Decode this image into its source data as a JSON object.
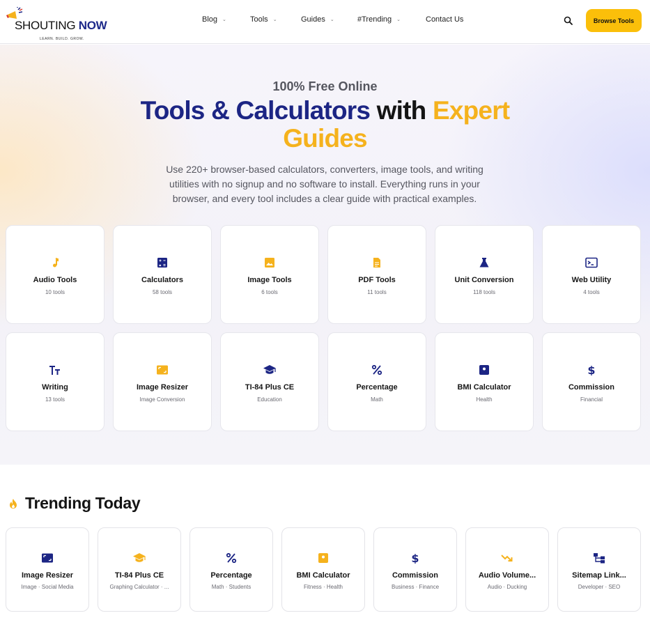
{
  "header": {
    "logo_main": "SHOUTING",
    "logo_accent": "NOW",
    "logo_tagline": "LEARN. BUILD. GROW.",
    "nav": [
      {
        "label": "Blog",
        "has_dropdown": true
      },
      {
        "label": "Tools",
        "has_dropdown": true
      },
      {
        "label": "Guides",
        "has_dropdown": true
      },
      {
        "label": "#Trending",
        "has_dropdown": true
      },
      {
        "label": "Contact Us",
        "has_dropdown": false
      }
    ],
    "search_icon": "search-icon",
    "cta_label": "Browse Tools"
  },
  "hero": {
    "eyebrow": "100% Free Online",
    "title_part1": "Tools & Calculators",
    "title_part2": "with",
    "title_part3": "Expert",
    "title_part4": "Guides",
    "description": "Use 220+ browser-based calculators, converters, image tools, and writing utilities with no signup and no software to install. Everything runs in your browser, and every tool includes a clear guide with practical examples."
  },
  "categories": [
    {
      "title": "Audio Tools",
      "subtitle": "10 tools",
      "icon": "music-note-icon",
      "color": "#f5b21d"
    },
    {
      "title": "Calculators",
      "subtitle": "58 tools",
      "icon": "calculator-icon",
      "color": "#1c2584"
    },
    {
      "title": "Image Tools",
      "subtitle": "6 tools",
      "icon": "image-icon",
      "color": "#f5b21d"
    },
    {
      "title": "PDF Tools",
      "subtitle": "11 tools",
      "icon": "document-icon",
      "color": "#f5b21d"
    },
    {
      "title": "Unit Conversion",
      "subtitle": "118 tools",
      "icon": "flask-icon",
      "color": "#1c2584"
    },
    {
      "title": "Web Utility",
      "subtitle": "4 tools",
      "icon": "terminal-icon",
      "color": "#1c2584"
    }
  ],
  "featured": [
    {
      "title": "Writing",
      "subtitle": "13 tools",
      "icon": "text-size-icon",
      "color": "#1c2584"
    },
    {
      "title": "Image Resizer",
      "subtitle": "Image Conversion",
      "icon": "photo-size-icon",
      "color": "#f5b21d"
    },
    {
      "title": "TI-84 Plus CE",
      "subtitle": "Education",
      "icon": "graduation-cap-icon",
      "color": "#1c2584"
    },
    {
      "title": "Percentage",
      "subtitle": "Math",
      "icon": "percent-icon",
      "color": "#1c2584"
    },
    {
      "title": "BMI Calculator",
      "subtitle": "Health",
      "icon": "scale-icon",
      "color": "#1c2584"
    },
    {
      "title": "Commission",
      "subtitle": "Financial",
      "icon": "dollar-icon",
      "color": "#1c2584"
    }
  ],
  "trending": {
    "title": "Trending Today",
    "icon": "flame-icon",
    "items": [
      {
        "title": "Image Resizer",
        "subtitle": "Image · Social Media",
        "icon": "photo-size-icon",
        "color": "#1c2584"
      },
      {
        "title": "TI-84 Plus CE",
        "subtitle": "Graphing Calculator · ...",
        "icon": "graduation-cap-icon",
        "color": "#f5b21d"
      },
      {
        "title": "Percentage",
        "subtitle": "Math · Students",
        "icon": "percent-icon",
        "color": "#1c2584"
      },
      {
        "title": "BMI Calculator",
        "subtitle": "Fitness · Health",
        "icon": "scale-icon",
        "color": "#f5b21d"
      },
      {
        "title": "Commission",
        "subtitle": "Business · Finance",
        "icon": "dollar-icon",
        "color": "#1c2584"
      },
      {
        "title": "Audio Volume...",
        "subtitle": "Audio · Ducking",
        "icon": "trending-down-icon",
        "color": "#f5b21d"
      },
      {
        "title": "Sitemap Link...",
        "subtitle": "Developer · SEO",
        "icon": "sitemap-icon",
        "color": "#1c2584"
      }
    ]
  }
}
